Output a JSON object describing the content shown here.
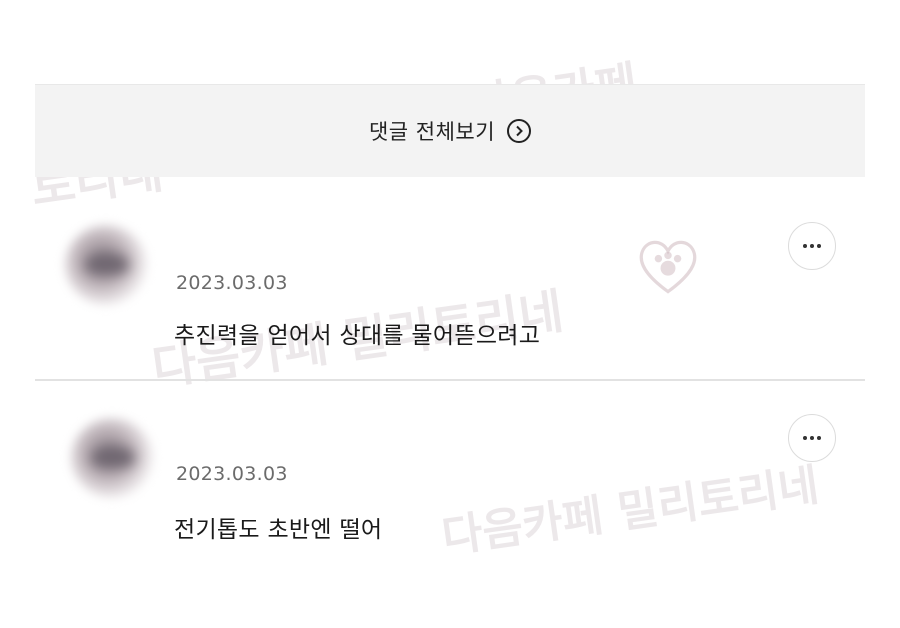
{
  "view_all": {
    "label": "댓글 전체보기"
  },
  "comments": [
    {
      "date": "2023.03.03",
      "text": "추진력을 얻어서 상대를 물어뜯으려고"
    },
    {
      "date": "2023.03.03",
      "text": "전기톱도 초반엔 떨어"
    }
  ],
  "watermarks": [
    "다음카페",
    "밀리토리네",
    "토리네",
    "다음카페 밀리토리네",
    "다음카페 밀리토리네"
  ],
  "colors": {
    "banner_bg": "#f3f3f3",
    "divider": "#e2e2e2",
    "date": "#6b6b6b"
  },
  "icons": [
    "chevron-right-circle-icon",
    "more-options-icon",
    "heart-paw-watermark-icon"
  ]
}
